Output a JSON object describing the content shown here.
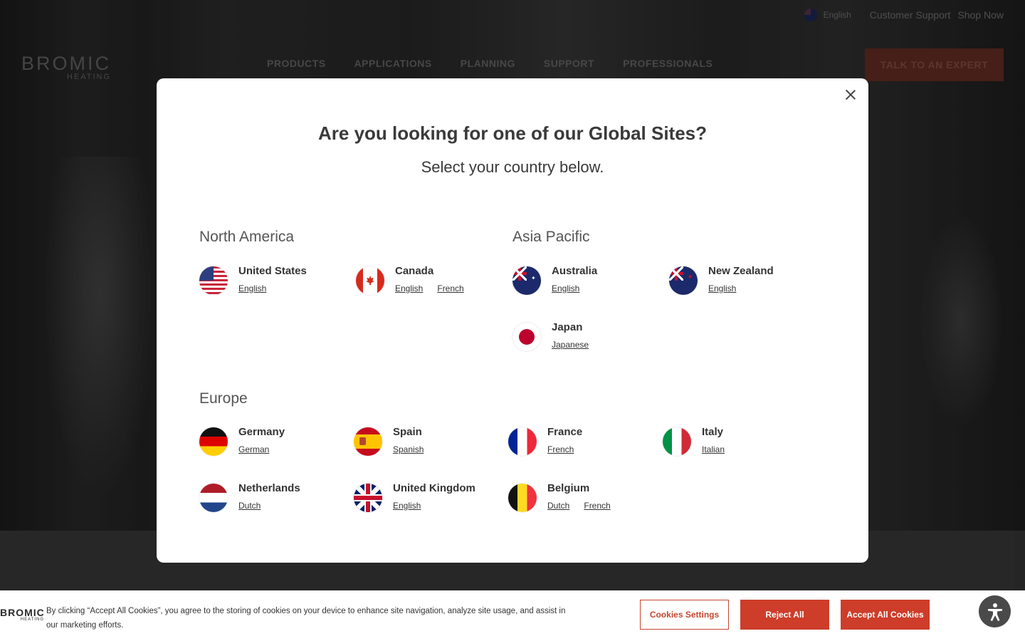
{
  "header": {
    "language": "English",
    "customer_support": "Customer Support",
    "shop_now": "Shop Now",
    "logo": "BROMIC",
    "logo_sub": "HEATING",
    "nav": [
      "PRODUCTS",
      "APPLICATIONS",
      "PLANNING",
      "SUPPORT",
      "PROFESSIONALS"
    ],
    "cta": "TALK TO AN EXPERT"
  },
  "modal": {
    "title": "Are you looking for one of our Global Sites?",
    "subtitle": "Select your country below.",
    "regions": {
      "north_america": {
        "title": "North America",
        "countries": [
          {
            "name": "United States",
            "flag": "us-flag-icon",
            "langs": [
              "English"
            ]
          },
          {
            "name": "Canada",
            "flag": "canada-flag-icon",
            "langs": [
              "English",
              "French"
            ]
          }
        ]
      },
      "asia_pacific": {
        "title": "Asia Pacific",
        "countries": [
          {
            "name": "Australia",
            "flag": "australia-flag-icon",
            "langs": [
              "English"
            ]
          },
          {
            "name": "New Zealand",
            "flag": "new-zealand-flag-icon",
            "langs": [
              "English"
            ]
          },
          {
            "name": "Japan",
            "flag": "japan-flag-icon",
            "langs": [
              "Japanese"
            ]
          }
        ]
      },
      "europe": {
        "title": "Europe",
        "countries": [
          {
            "name": "Germany",
            "flag": "germany-flag-icon",
            "langs": [
              "German"
            ]
          },
          {
            "name": "Spain",
            "flag": "spain-flag-icon",
            "langs": [
              "Spanish"
            ]
          },
          {
            "name": "France",
            "flag": "france-flag-icon",
            "langs": [
              "French"
            ]
          },
          {
            "name": "Italy",
            "flag": "italy-flag-icon",
            "langs": [
              "Italian"
            ]
          },
          {
            "name": "Netherlands",
            "flag": "netherlands-flag-icon",
            "langs": [
              "Dutch"
            ]
          },
          {
            "name": "United Kingdom",
            "flag": "uk-flag-icon",
            "langs": [
              "English"
            ]
          },
          {
            "name": "Belgium",
            "flag": "belgium-flag-icon",
            "langs": [
              "Dutch",
              "French"
            ]
          }
        ]
      }
    }
  },
  "cookie": {
    "logo": "BROMIC",
    "logo_sub": "HEATING",
    "text": "By clicking “Accept All Cookies”, you agree to the storing of cookies on your device to enhance site navigation, analyze site usage, and assist in our marketing efforts.",
    "settings": "Cookies Settings",
    "reject": "Reject All",
    "accept": "Accept All Cookies"
  },
  "colors": {
    "accent": "#cd3d2a",
    "modal_bg": "#ffffff"
  }
}
